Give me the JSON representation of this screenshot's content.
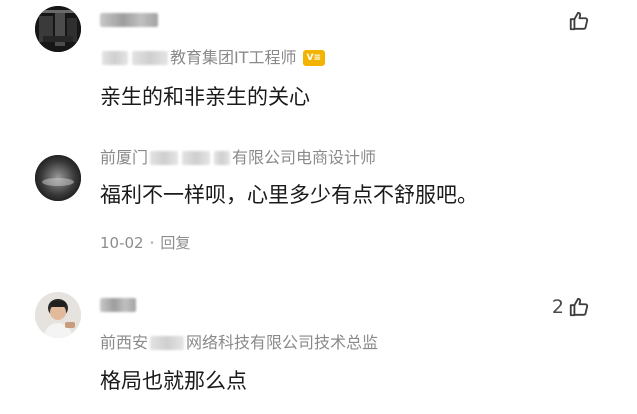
{
  "comments": [
    {
      "title_suffix": "教育集团IT工程师",
      "badge_text": "V≡",
      "body": "亲生的和非亲生的关心",
      "like_count": ""
    },
    {
      "title_prefix": "前厦门",
      "title_suffix": "有限公司电商设计师",
      "body": "福利不一样呗，心里多少有点不舒服吧。",
      "date": "10-02",
      "separator": "·",
      "reply_label": "回复"
    },
    {
      "title_prefix": "前西安",
      "title_suffix": "网络科技有限公司技术总监",
      "body": "格局也就那么点",
      "like_count": "2"
    }
  ],
  "icons": {
    "like": "thumbs-up-icon",
    "avatar": "avatar"
  },
  "colors": {
    "meta_grey": "#8a8a8a",
    "badge_yellow": "#f2b400"
  }
}
